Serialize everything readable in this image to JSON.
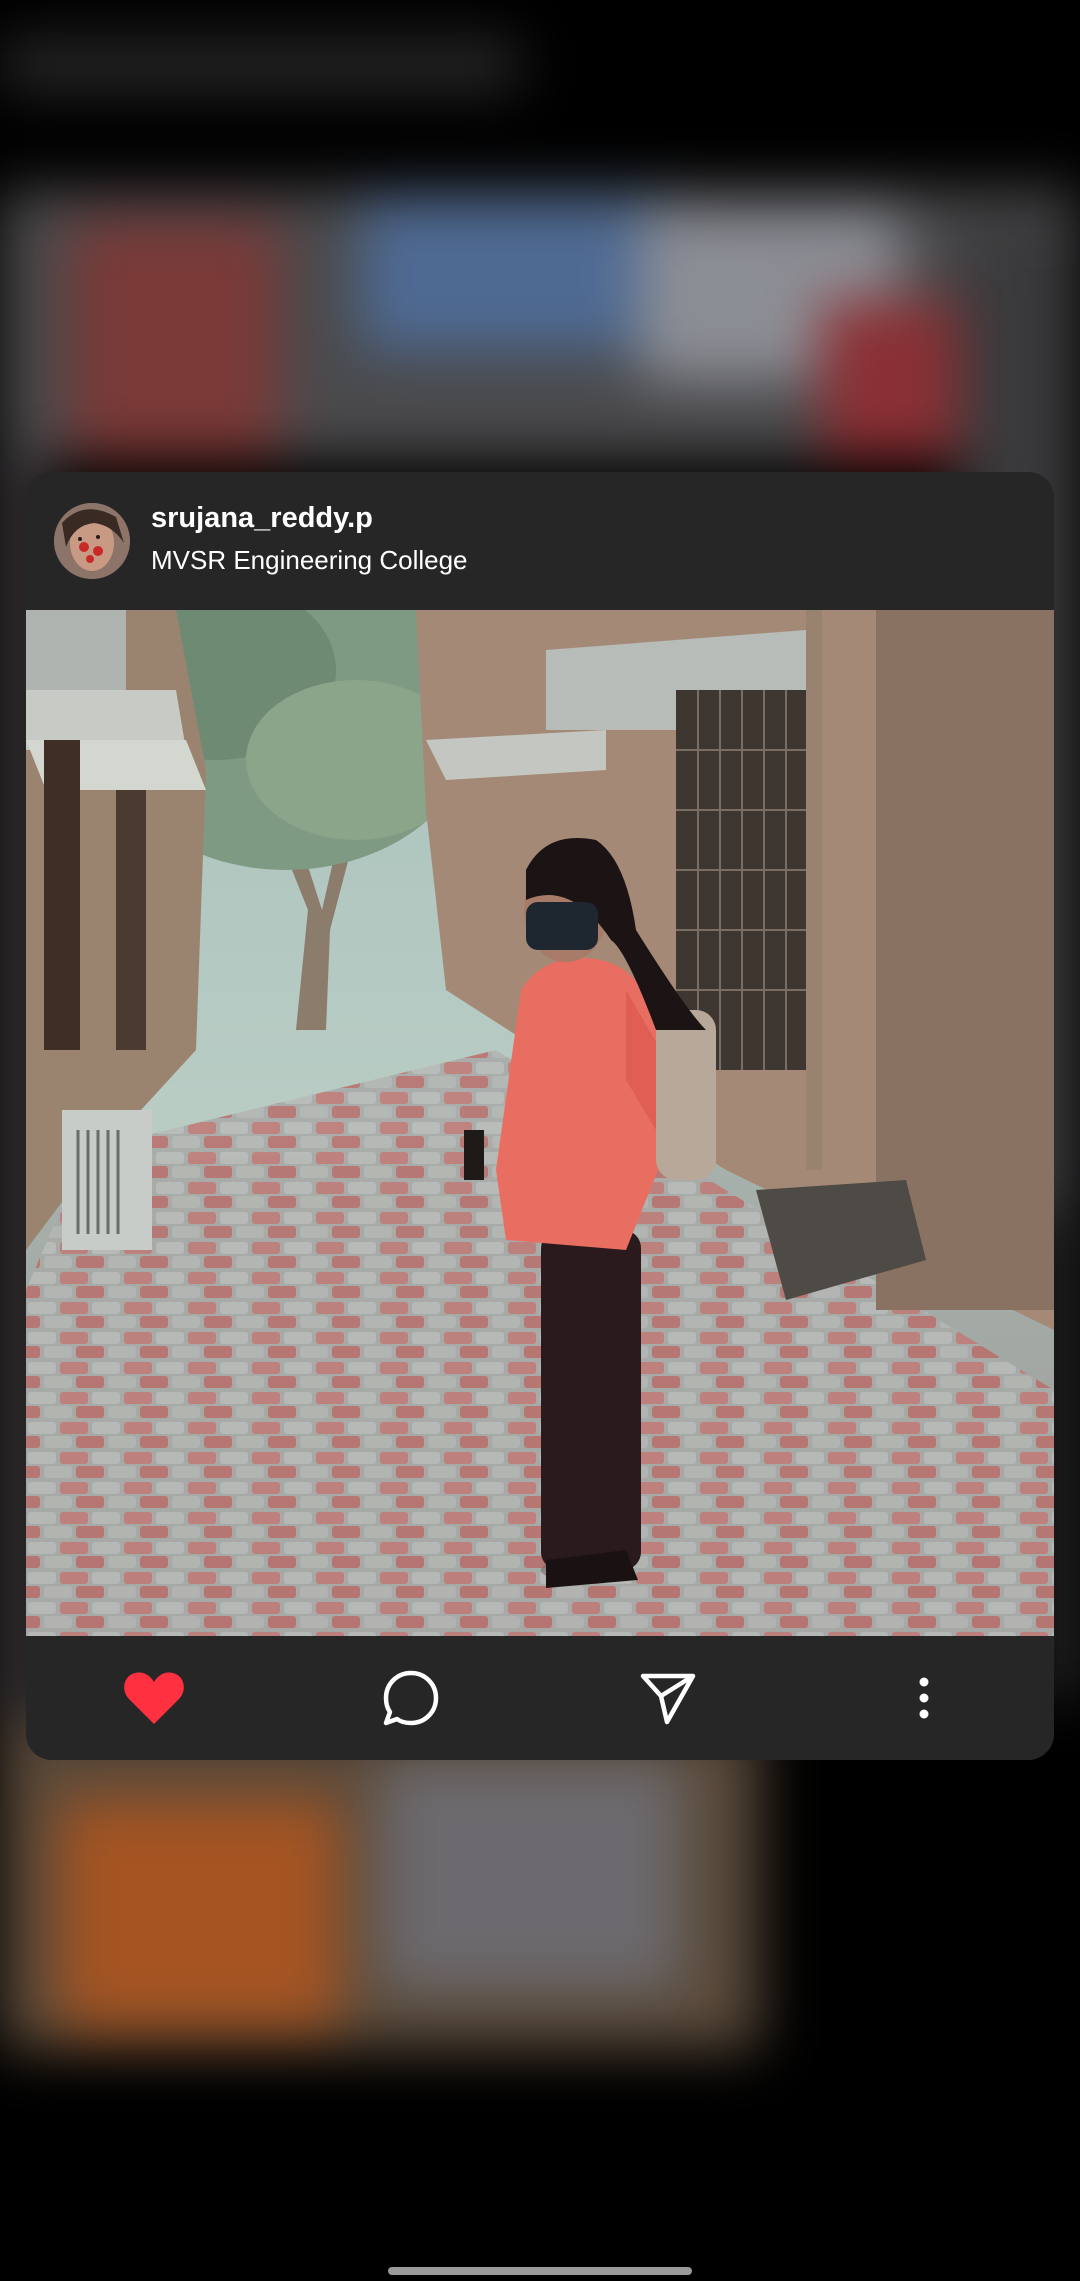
{
  "post": {
    "username": "srujana_reddy.p",
    "location": "MVSR Engineering College"
  },
  "actions": {
    "like_icon": "heart-icon",
    "comment_icon": "comment-icon",
    "share_icon": "send-icon",
    "more_icon": "more-vertical-icon",
    "like_color": "#ff3040"
  },
  "colors": {
    "card_background": "#262626",
    "screen_background": "#000000"
  }
}
